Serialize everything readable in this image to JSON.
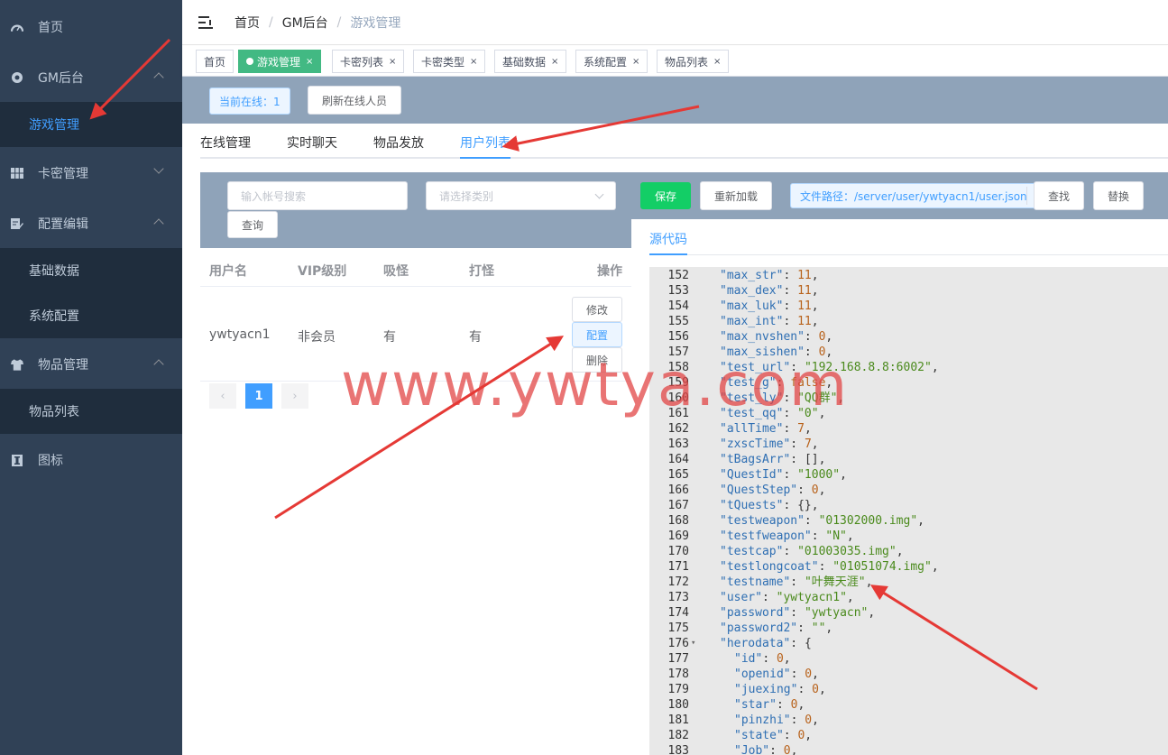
{
  "sidebar": {
    "items": [
      {
        "label": "首页",
        "icon": "dashboard-icon"
      },
      {
        "label": "GM后台",
        "icon": "lifebuoy-icon"
      },
      {
        "label": "游戏管理",
        "sub": true,
        "active": true
      },
      {
        "label": "卡密管理",
        "icon": "grid-icon"
      },
      {
        "label": "配置编辑",
        "icon": "edit-icon"
      },
      {
        "label": "基础数据",
        "sub": true
      },
      {
        "label": "系统配置",
        "sub": true
      },
      {
        "label": "物品管理",
        "icon": "shirt-icon"
      },
      {
        "label": "物品列表",
        "sub": true
      },
      {
        "label": "图标",
        "icon": "info-icon"
      }
    ]
  },
  "breadcrumb": [
    "首页",
    "GM后台",
    "游戏管理"
  ],
  "tags": [
    {
      "label": "首页"
    },
    {
      "label": "游戏管理",
      "active": true
    },
    {
      "label": "卡密列表"
    },
    {
      "label": "卡密类型"
    },
    {
      "label": "基础数据"
    },
    {
      "label": "系统配置"
    },
    {
      "label": "物品列表"
    }
  ],
  "tag_close": "×",
  "online": {
    "label": "当前在线：1",
    "refresh": "刷新在线人员"
  },
  "tabs": [
    "在线管理",
    "实时聊天",
    "物品发放",
    "用户列表"
  ],
  "filter": {
    "account_placeholder": "输入帐号搜索",
    "type_placeholder": "请选择类别",
    "query": "查询"
  },
  "table": {
    "headers": [
      "用户名",
      "VIP级别",
      "吸怪",
      "打怪",
      "操作"
    ],
    "rows": [
      {
        "user": "ywtyacn1",
        "vip": "非会员",
        "absorb": "有",
        "attack": "有"
      }
    ],
    "actions": [
      "修改",
      "配置",
      "删除"
    ]
  },
  "pagination": {
    "prev": "‹",
    "current": "1",
    "next": "›"
  },
  "editor": {
    "save": "保存",
    "reload": "重新加载",
    "path": "文件路径：/server/user/ywtyacn1/user.json",
    "find": "查找",
    "replace": "替换",
    "tab": "源代码"
  },
  "code_lines": [
    {
      "n": "152",
      "k": "\"max_str\"",
      "v": "11",
      "t": "n"
    },
    {
      "n": "153",
      "k": "\"max_dex\"",
      "v": "11",
      "t": "n"
    },
    {
      "n": "154",
      "k": "\"max_luk\"",
      "v": "11",
      "t": "n"
    },
    {
      "n": "155",
      "k": "\"max_int\"",
      "v": "11",
      "t": "n"
    },
    {
      "n": "156",
      "k": "\"max_nvshen\"",
      "v": "0",
      "t": "n"
    },
    {
      "n": "157",
      "k": "\"max_sishen\"",
      "v": "0",
      "t": "n"
    },
    {
      "n": "158",
      "k": "\"test_url\"",
      "v": "\"192.168.8.8:6002\"",
      "t": "s"
    },
    {
      "n": "159",
      "k": "\"test_g\"",
      "v": "false",
      "t": "b"
    },
    {
      "n": "160",
      "k": "\"test_ly\"",
      "v": "\"QQ群\"",
      "t": "s"
    },
    {
      "n": "161",
      "k": "\"test_qq\"",
      "v": "\"0\"",
      "t": "s"
    },
    {
      "n": "162",
      "k": "\"allTime\"",
      "v": "7",
      "t": "n"
    },
    {
      "n": "163",
      "k": "\"zxscTime\"",
      "v": "7",
      "t": "n"
    },
    {
      "n": "164",
      "k": "\"tBagsArr\"",
      "v": "[]",
      "t": "p"
    },
    {
      "n": "165",
      "k": "\"QuestId\"",
      "v": "\"1000\"",
      "t": "s"
    },
    {
      "n": "166",
      "k": "\"QuestStep\"",
      "v": "0",
      "t": "n"
    },
    {
      "n": "167",
      "k": "\"tQuests\"",
      "v": "{}",
      "t": "p"
    },
    {
      "n": "168",
      "k": "\"testweapon\"",
      "v": "\"01302000.img\"",
      "t": "s"
    },
    {
      "n": "169",
      "k": "\"testfweapon\"",
      "v": "\"N\"",
      "t": "s"
    },
    {
      "n": "170",
      "k": "\"testcap\"",
      "v": "\"01003035.img\"",
      "t": "s"
    },
    {
      "n": "171",
      "k": "\"testlongcoat\"",
      "v": "\"01051074.img\"",
      "t": "s"
    },
    {
      "n": "172",
      "k": "\"testname\"",
      "v": "\"叶舞天涯\"",
      "t": "s"
    },
    {
      "n": "173",
      "k": "\"user\"",
      "v": "\"ywtyacn1\"",
      "t": "s"
    },
    {
      "n": "174",
      "k": "\"password\"",
      "v": "\"ywtyacn\"",
      "t": "s"
    },
    {
      "n": "175",
      "k": "\"password2\"",
      "v": "\"\"",
      "t": "s"
    },
    {
      "n": "176",
      "k": "\"herodata\"",
      "v": "{",
      "t": "p",
      "fold": true,
      "open": true
    },
    {
      "n": "177",
      "k": "\"id\"",
      "v": "0",
      "t": "n",
      "ind": 1
    },
    {
      "n": "178",
      "k": "\"openid\"",
      "v": "0",
      "t": "n",
      "ind": 1
    },
    {
      "n": "179",
      "k": "\"juexing\"",
      "v": "0",
      "t": "n",
      "ind": 1
    },
    {
      "n": "180",
      "k": "\"star\"",
      "v": "0",
      "t": "n",
      "ind": 1
    },
    {
      "n": "181",
      "k": "\"pinzhi\"",
      "v": "0",
      "t": "n",
      "ind": 1
    },
    {
      "n": "182",
      "k": "\"state\"",
      "v": "0",
      "t": "n",
      "ind": 1
    },
    {
      "n": "183",
      "k": "\"Job\"",
      "v": "0",
      "t": "n",
      "ind": 1
    }
  ],
  "watermark": "www.ywtya.com",
  "colors": {
    "sidebar": "#304156",
    "accent": "#409eff",
    "save": "#13ce66",
    "tag_active": "#42b983",
    "arrow": "#e53935"
  }
}
